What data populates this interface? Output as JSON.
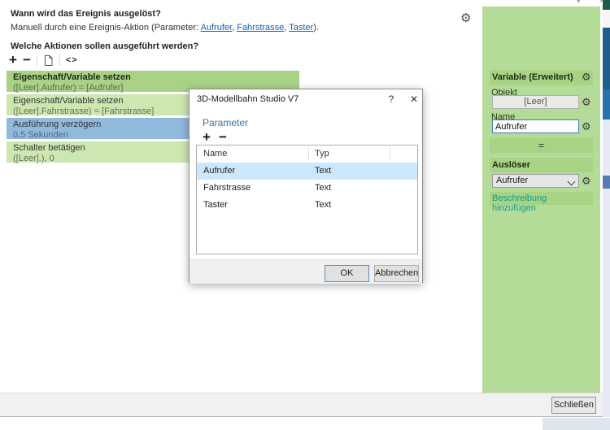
{
  "editor": {
    "question1": "Wann wird das Ereignis ausgelöst?",
    "trigger": {
      "prefix": "Manuell durch eine Ereignis-Aktion (Parameter: ",
      "links": [
        "Aufrufer",
        "Fahrstrasse",
        "Taster"
      ],
      "sep": ", ",
      "suffix": ")."
    },
    "question2": "Welche Aktionen sollen ausgeführt werden?",
    "toolbar": {
      "add": "+",
      "remove": "−",
      "code": "<>"
    },
    "actions": [
      {
        "title": "Eigenschaft/Variable setzen",
        "detail": "([Leer].Aufrufer) = [Aufrufer]",
        "state": "selected"
      },
      {
        "title": "Eigenschaft/Variable setzen",
        "detail": "([Leer].Fahrstrasse) = [Fahrstrasse]",
        "state": "normal"
      },
      {
        "title": "Ausführung verzögern",
        "detail": "0,5 Sekunden",
        "state": "delay"
      },
      {
        "title": "Schalter betätigen",
        "detail": "([Leer].), 0",
        "state": "normal"
      }
    ]
  },
  "dialog": {
    "title": "3D-Modellbahn Studio V7",
    "help_icon": "?",
    "close_icon": "✕",
    "heading": "Parameter",
    "toolbar": {
      "add": "+",
      "remove": "−"
    },
    "table": {
      "columns": [
        "Name",
        "Typ"
      ],
      "rows": [
        {
          "name": "Aufrufer",
          "typ": "Text",
          "selected": true
        },
        {
          "name": "Fahrstrasse",
          "typ": "Text",
          "selected": false
        },
        {
          "name": "Taster",
          "typ": "Text",
          "selected": false
        }
      ]
    },
    "ok_label": "OK",
    "cancel_label": "Abbrechen"
  },
  "sidebar": {
    "header": "Variable (Erweitert)",
    "objekt_label": "Objekt",
    "objekt_value": "[Leer]",
    "name_label": "Name",
    "name_value": "Aufrufer",
    "equals": "=",
    "ausloeser_label": "Auslöser",
    "ausloeser_value": "Aufrufer",
    "description_link": "Beschreibung hinzufügen",
    "gear_icon": "⚙"
  },
  "footer": {
    "close_label": "Schließen"
  },
  "colors": {
    "panel_green": "#b4db97",
    "strip_green": "#a8d384",
    "action_selected": "#a9d286",
    "action_normal": "#cde7b1",
    "action_delay": "#90b9dc",
    "selected_row": "#cde8fc",
    "link_blue": "#0b61c2",
    "teal_link": "#0f9b8e"
  }
}
